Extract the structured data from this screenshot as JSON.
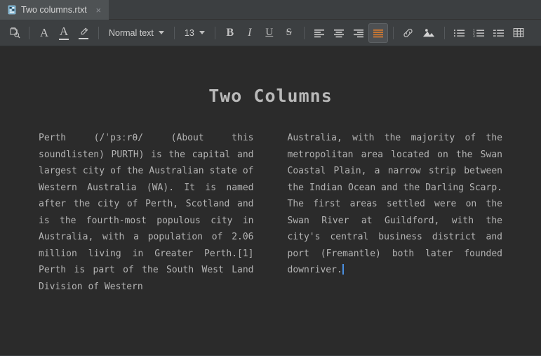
{
  "window": {
    "bg": "#2b2b2b",
    "chrome_bg": "#3c3f41",
    "accent": "#cc7832",
    "caret_color": "#4a90e2",
    "text_color": "#b4b4b4"
  },
  "tabbar": {
    "tabs": [
      {
        "title": "Two columns.rtxt",
        "icon": "rtf-file-icon",
        "close_label": "×",
        "active": true
      }
    ]
  },
  "toolbar": {
    "groups": [
      {
        "name": "view",
        "items": [
          {
            "name": "print-preview-icon",
            "label": "Print preview",
            "icon": "document-search-icon",
            "active": false
          }
        ]
      },
      {
        "name": "font",
        "items": [
          {
            "name": "font-style-button",
            "label": "A",
            "icon": "font-style-icon",
            "active": false
          },
          {
            "name": "text-color-button",
            "label": "A",
            "icon": "text-color-icon",
            "active": false
          },
          {
            "name": "highlight-color-button",
            "label": "",
            "icon": "highlighter-icon",
            "active": false
          }
        ]
      },
      {
        "name": "paragraph-style",
        "style_value": "Normal text",
        "style_options": [
          "Normal text"
        ],
        "size_value": "13",
        "size_options": [
          "13"
        ]
      },
      {
        "name": "emphasis",
        "items": [
          {
            "name": "bold-button",
            "label": "B",
            "icon": "bold-icon",
            "active": false
          },
          {
            "name": "italic-button",
            "label": "I",
            "icon": "italic-icon",
            "active": false
          },
          {
            "name": "underline-button",
            "label": "U",
            "icon": "underline-icon",
            "active": false
          },
          {
            "name": "strikethrough-button",
            "label": "S",
            "icon": "strikethrough-icon",
            "active": false
          }
        ]
      },
      {
        "name": "alignment",
        "items": [
          {
            "name": "align-left-button",
            "label": "Align left",
            "icon": "align-left-icon",
            "active": false
          },
          {
            "name": "align-center-button",
            "label": "Align center",
            "icon": "align-center-icon",
            "active": false
          },
          {
            "name": "align-right-button",
            "label": "Align right",
            "icon": "align-right-icon",
            "active": false
          },
          {
            "name": "align-justify-button",
            "label": "Justify",
            "icon": "align-justify-icon",
            "active": true
          }
        ]
      },
      {
        "name": "insert",
        "items": [
          {
            "name": "insert-link-button",
            "label": "Insert link",
            "icon": "link-icon",
            "active": false
          },
          {
            "name": "insert-image-button",
            "label": "Insert image",
            "icon": "image-icon",
            "active": false
          }
        ]
      },
      {
        "name": "lists",
        "items": [
          {
            "name": "bulleted-list-button",
            "label": "Bulleted list",
            "icon": "bulleted-list-icon",
            "active": false
          },
          {
            "name": "numbered-list-button",
            "label": "Numbered list",
            "icon": "numbered-list-icon",
            "active": false
          },
          {
            "name": "multilevel-list-button",
            "label": "Multilevel list",
            "icon": "multilevel-list-icon",
            "active": false
          },
          {
            "name": "insert-table-button",
            "label": "Insert table",
            "icon": "table-icon",
            "active": false
          }
        ]
      }
    ]
  },
  "document": {
    "title": "Two Columns",
    "columns": [
      {
        "name": "left-column",
        "text": "Perth (/ˈpɜːrθ/ (About this soundlisten) PURTH) is the capital and largest city of the Australian state of Western Australia (WA). It is named after the city of Perth, Scotland and is the fourth-most populous city in Australia, with a population of 2.06 million living in Greater Perth.[1] Perth is part of the South West Land Division of Western"
      },
      {
        "name": "right-column",
        "text": "Australia, with the majority of the metropolitan area located on the Swan Coastal Plain, a narrow strip between the Indian Ocean and the Darling Scarp. The first areas settled were on the Swan River at Guildford, with the city's central business district and port (Fremantle) both later founded downriver.",
        "has_caret": true
      }
    ]
  }
}
